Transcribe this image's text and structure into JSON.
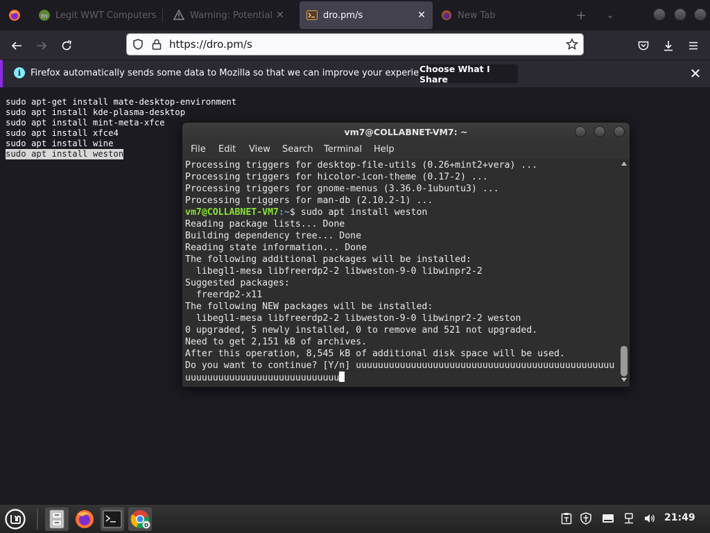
{
  "browser": {
    "tabs": [
      {
        "title": "Legit WWT Computers",
        "favicon": "mint-logo-icon",
        "state": "inactive"
      },
      {
        "title": "Warning: Potential Security Risk",
        "favicon": "warning-icon",
        "state": "inactive"
      },
      {
        "title": "dro.pm/s",
        "favicon": "terminal-page-icon",
        "state": "active"
      },
      {
        "title": "New Tab",
        "favicon": "firefox-icon",
        "state": "inactive"
      }
    ],
    "url": "https://dro.pm/s",
    "notification": {
      "text": "Firefox automatically sends some data to Mozilla so that we can improve your experience.",
      "button": "Choose What I Share"
    }
  },
  "page": {
    "lines": [
      "sudo apt-get install mate-desktop-environment",
      "sudo apt install kde-plasma-desktop",
      "sudo apt install mint-meta-xfce",
      "sudo apt install xfce4",
      "sudo apt install wine",
      "sudo apt install weston"
    ],
    "selected_line": "sudo apt install weston"
  },
  "terminal": {
    "title": "vm7@COLLABNET-VM7: ~",
    "menu": [
      "File",
      "Edit",
      "View",
      "Search",
      "Terminal",
      "Help"
    ],
    "lines_before_prompt": [
      "Processing triggers for desktop-file-utils (0.26+mint2+vera) ...",
      "Processing triggers for hicolor-icon-theme (0.17-2) ...",
      "Processing triggers for gnome-menus (3.36.0-1ubuntu3) ...",
      "Processing triggers for man-db (2.10.2-1) ..."
    ],
    "prompt_user": "vm7@COLLABNET-VM7",
    "prompt_path": ":~",
    "prompt_command": "$ sudo apt install weston",
    "lines_after_prompt": [
      "Reading package lists... Done",
      "Building dependency tree... Done",
      "Reading state information... Done",
      "The following additional packages will be installed:",
      "  libegl1-mesa libfreerdp2-2 libweston-9-0 libwinpr2-2",
      "Suggested packages:",
      "  freerdp2-x11",
      "The following NEW packages will be installed:",
      "  libegl1-mesa libfreerdp2-2 libweston-9-0 libwinpr2-2 weston",
      "0 upgraded, 5 newly installed, 0 to remove and 521 not upgraded.",
      "Need to get 2,151 kB of archives.",
      "After this operation, 8,545 kB of additional disk space will be used.",
      "Do you want to continue? [Y/n] uuuuuuuuuuuuuuuuuuuuuuuuuuuuuuuuuuuuuuuuuuuuuuu"
    ],
    "last_line": "uuuuuuuuuuuuuuuuuuuuuuuuuuuu"
  },
  "taskbar": {
    "items": [
      "menu-button",
      "file-manager",
      "firefox",
      "terminal",
      "chrome"
    ],
    "clock": "21:49"
  },
  "colors": {
    "notification_accent": "#8a2be2",
    "prompt_user": "#8ae234",
    "prompt_path": "#729fcf"
  }
}
